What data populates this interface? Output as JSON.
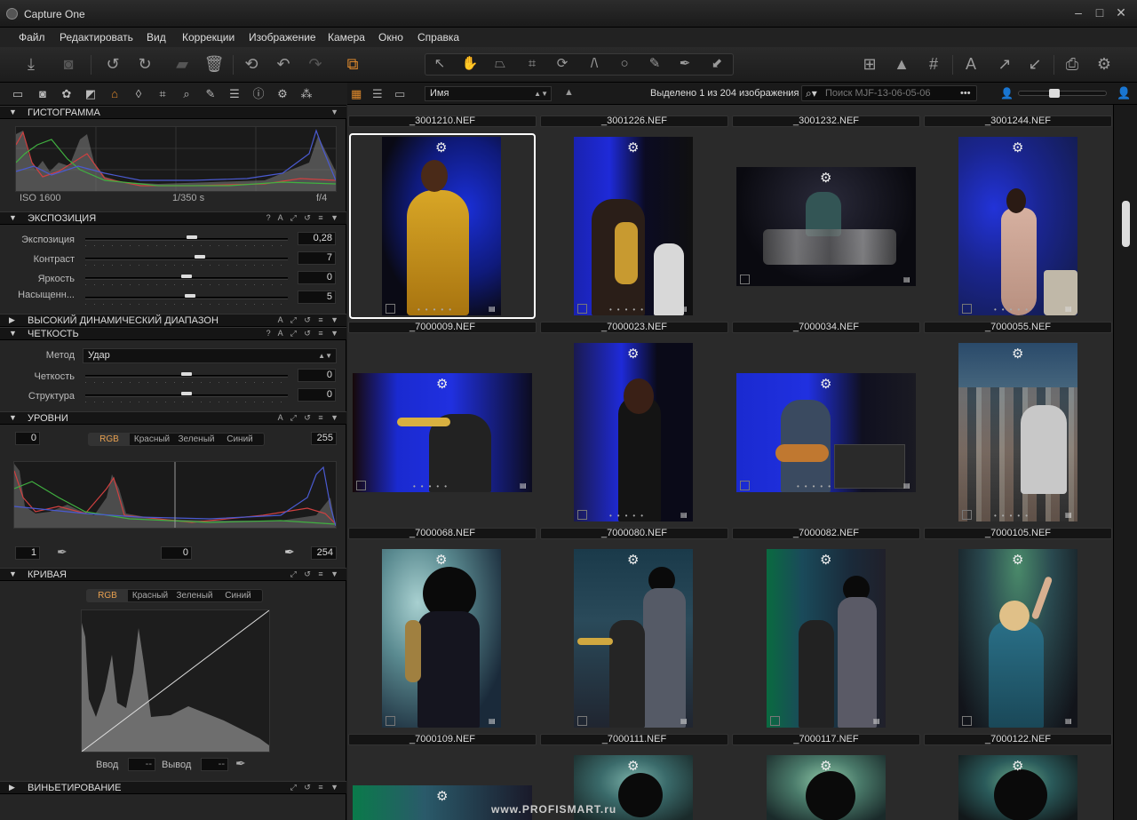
{
  "app": {
    "title": "Capture One"
  },
  "menu": [
    "Файл",
    "Редактировать",
    "Вид",
    "Коррекции",
    "Изображение",
    "Камера",
    "Окно",
    "Справка"
  ],
  "histogram": {
    "title": "ГИСТОГРАММА",
    "iso": "ISO 1600",
    "shutter": "1/350 s",
    "aperture": "f/4"
  },
  "exposure": {
    "title": "ЭКСПОЗИЦИЯ",
    "rows": [
      {
        "label": "Экспозиция",
        "value": "0,28"
      },
      {
        "label": "Контраст",
        "value": "7"
      },
      {
        "label": "Яркость",
        "value": "0"
      },
      {
        "label": "Насыщенн...",
        "value": "5"
      }
    ]
  },
  "hdr": {
    "title": "ВЫСОКИЙ ДИНАМИЧЕСКИЙ ДИАПАЗОН"
  },
  "clarity": {
    "title": "ЧЕТКОСТЬ",
    "method_label": "Метод",
    "method_value": "Удар",
    "rows": [
      {
        "label": "Четкость",
        "value": "0"
      },
      {
        "label": "Структура",
        "value": "0"
      }
    ]
  },
  "levels": {
    "title": "УРОВНИ",
    "in_low": "0",
    "in_high": "255",
    "channels": [
      "RGB",
      "Красный",
      "Зеленый",
      "Синий"
    ],
    "out_low": "1",
    "mid": "0",
    "out_high": "254"
  },
  "curve": {
    "title": "КРИВАЯ",
    "channels": [
      "RGB",
      "Красный",
      "Зеленый",
      "Синий"
    ],
    "input_label": "Ввод",
    "input_value": "--",
    "output_label": "Вывод",
    "output_value": "--"
  },
  "vignette": {
    "title": "ВИНЬЕТИРОВАНИЕ"
  },
  "browser": {
    "sort": "Имя",
    "selection_info": "Выделено 1 из 204 изображения",
    "search_placeholder": "Поиск MJF-13-06-05-06",
    "captions": [
      "_3001210.NEF",
      "_3001226.NEF",
      "_3001232.NEF",
      "_3001244.NEF",
      "_7000009.NEF",
      "_7000023.NEF",
      "_7000034.NEF",
      "_7000055.NEF",
      "_7000068.NEF",
      "_7000080.NEF",
      "_7000082.NEF",
      "_7000105.NEF",
      "_7000109.NEF",
      "_7000111.NEF",
      "_7000117.NEF",
      "_7000122.NEF"
    ]
  },
  "watermark": "www.PROFISMART.ru",
  "colors": {
    "accent": "#e08a2c",
    "selection": "#ffffff"
  }
}
